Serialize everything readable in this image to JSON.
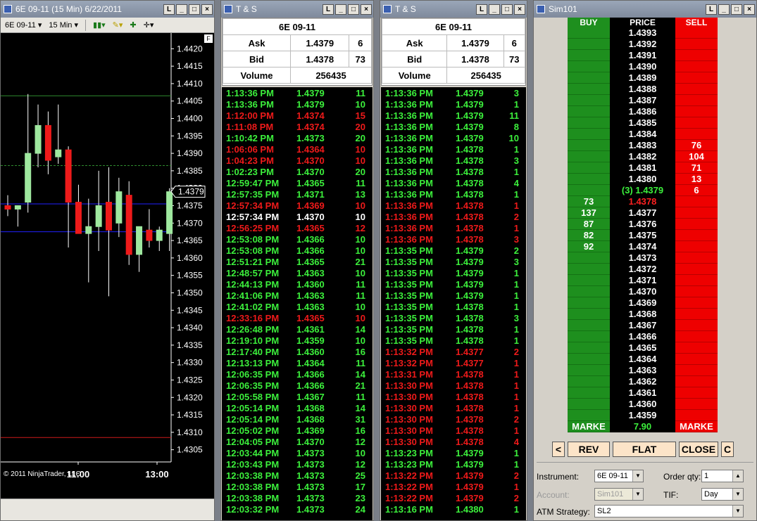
{
  "chart": {
    "title": "6E 09-11 (15 Min)  6/22/2011",
    "instrument": "6E 09-11",
    "interval": "15 Min",
    "copyright": "© 2011 NinjaTrader, LLC",
    "f_label": "F",
    "current_price": "1.4379",
    "y_ticks": [
      "1.4420",
      "1.4415",
      "1.4410",
      "1.4405",
      "1.4400",
      "1.4395",
      "1.4390",
      "1.4385",
      "1.4380",
      "1.4375",
      "1.4370",
      "1.4365",
      "1.4360",
      "1.4355",
      "1.4350",
      "1.4345",
      "1.4340",
      "1.4335",
      "1.4330",
      "1.4325",
      "1.4320",
      "1.4315",
      "1.4310",
      "1.4305"
    ],
    "x_ticks": [
      "11:00",
      "13:00"
    ],
    "candles": [
      {
        "o": 1.4375,
        "h": 1.4378,
        "l": 1.4372,
        "c": 1.4374
      },
      {
        "o": 1.4374,
        "h": 1.4375,
        "l": 1.4369,
        "c": 1.4375
      },
      {
        "o": 1.4376,
        "h": 1.4407,
        "l": 1.4373,
        "c": 1.439
      },
      {
        "o": 1.439,
        "h": 1.4404,
        "l": 1.4386,
        "c": 1.4398
      },
      {
        "o": 1.4398,
        "h": 1.4402,
        "l": 1.4384,
        "c": 1.4388
      },
      {
        "o": 1.4389,
        "h": 1.4404,
        "l": 1.4387,
        "c": 1.4391
      },
      {
        "o": 1.4391,
        "h": 1.4392,
        "l": 1.4363,
        "c": 1.4376
      },
      {
        "o": 1.4376,
        "h": 1.4381,
        "l": 1.4367,
        "c": 1.4367
      },
      {
        "o": 1.4367,
        "h": 1.4377,
        "l": 1.4353,
        "c": 1.4369
      },
      {
        "o": 1.4369,
        "h": 1.4385,
        "l": 1.4362,
        "c": 1.4375
      },
      {
        "o": 1.4376,
        "h": 1.4386,
        "l": 1.4349,
        "c": 1.4368
      },
      {
        "o": 1.437,
        "h": 1.4383,
        "l": 1.4366,
        "c": 1.4379
      },
      {
        "o": 1.4378,
        "h": 1.4382,
        "l": 1.4358,
        "c": 1.4361
      },
      {
        "o": 1.4361,
        "h": 1.4369,
        "l": 1.4356,
        "c": 1.4369
      },
      {
        "o": 1.4368,
        "h": 1.4374,
        "l": 1.4363,
        "c": 1.4365
      },
      {
        "o": 1.4365,
        "h": 1.4369,
        "l": 1.4362,
        "c": 1.4368
      },
      {
        "o": 1.4367,
        "h": 1.438,
        "l": 1.4362,
        "c": 1.4379
      }
    ],
    "h_lines": [
      {
        "price": 1.44065,
        "color": "#2e8b2e"
      },
      {
        "price": 1.43865,
        "color": "#2e8b2e"
      },
      {
        "price": 1.43755,
        "color": "#2020ff"
      },
      {
        "price": 1.43675,
        "color": "#2020ff"
      },
      {
        "price": 1.43085,
        "color": "#cc1a1a"
      }
    ]
  },
  "ts1": {
    "title": "T & S",
    "instrument": "6E 09-11",
    "ask_label": "Ask",
    "ask_price": "1.4379",
    "ask_size": "6",
    "bid_label": "Bid",
    "bid_price": "1.4378",
    "bid_size": "73",
    "volume_label": "Volume",
    "volume": "256435",
    "rows": [
      [
        "1:13:36 PM",
        "1.4379",
        "11",
        "g"
      ],
      [
        "1:13:36 PM",
        "1.4379",
        "10",
        "g"
      ],
      [
        "1:12:00 PM",
        "1.4374",
        "15",
        "r"
      ],
      [
        "1:11:08 PM",
        "1.4374",
        "20",
        "r"
      ],
      [
        "1:10:42 PM",
        "1.4373",
        "20",
        "g"
      ],
      [
        "1:06:06 PM",
        "1.4364",
        "10",
        "r"
      ],
      [
        "1:04:23 PM",
        "1.4370",
        "10",
        "r"
      ],
      [
        "1:02:23 PM",
        "1.4370",
        "20",
        "g"
      ],
      [
        "12:59:47 PM",
        "1.4365",
        "11",
        "g"
      ],
      [
        "12:57:35 PM",
        "1.4371",
        "13",
        "g"
      ],
      [
        "12:57:34 PM",
        "1.4369",
        "10",
        "r"
      ],
      [
        "12:57:34 PM",
        "1.4370",
        "10",
        "w"
      ],
      [
        "12:56:25 PM",
        "1.4365",
        "12",
        "r"
      ],
      [
        "12:53:08 PM",
        "1.4366",
        "10",
        "g"
      ],
      [
        "12:53:08 PM",
        "1.4366",
        "10",
        "g"
      ],
      [
        "12:51:21 PM",
        "1.4365",
        "21",
        "g"
      ],
      [
        "12:48:57 PM",
        "1.4363",
        "10",
        "g"
      ],
      [
        "12:44:13 PM",
        "1.4360",
        "11",
        "g"
      ],
      [
        "12:41:06 PM",
        "1.4363",
        "11",
        "g"
      ],
      [
        "12:41:02 PM",
        "1.4363",
        "10",
        "g"
      ],
      [
        "12:33:16 PM",
        "1.4365",
        "10",
        "r"
      ],
      [
        "12:26:48 PM",
        "1.4361",
        "14",
        "g"
      ],
      [
        "12:19:10 PM",
        "1.4359",
        "10",
        "g"
      ],
      [
        "12:17:40 PM",
        "1.4360",
        "16",
        "g"
      ],
      [
        "12:13:13 PM",
        "1.4364",
        "11",
        "g"
      ],
      [
        "12:06:35 PM",
        "1.4366",
        "14",
        "g"
      ],
      [
        "12:06:35 PM",
        "1.4366",
        "21",
        "g"
      ],
      [
        "12:05:58 PM",
        "1.4367",
        "11",
        "g"
      ],
      [
        "12:05:14 PM",
        "1.4368",
        "14",
        "g"
      ],
      [
        "12:05:14 PM",
        "1.4368",
        "31",
        "g"
      ],
      [
        "12:05:02 PM",
        "1.4369",
        "16",
        "g"
      ],
      [
        "12:04:05 PM",
        "1.4370",
        "12",
        "g"
      ],
      [
        "12:03:44 PM",
        "1.4373",
        "10",
        "g"
      ],
      [
        "12:03:43 PM",
        "1.4373",
        "12",
        "g"
      ],
      [
        "12:03:38 PM",
        "1.4373",
        "25",
        "g"
      ],
      [
        "12:03:38 PM",
        "1.4373",
        "17",
        "g"
      ],
      [
        "12:03:38 PM",
        "1.4373",
        "23",
        "g"
      ],
      [
        "12:03:32 PM",
        "1.4373",
        "24",
        "g"
      ]
    ]
  },
  "ts2": {
    "title": "T & S",
    "instrument": "6E 09-11",
    "ask_label": "Ask",
    "ask_price": "1.4379",
    "ask_size": "6",
    "bid_label": "Bid",
    "bid_price": "1.4378",
    "bid_size": "73",
    "volume_label": "Volume",
    "volume": "256435",
    "rows": [
      [
        "1:13:36 PM",
        "1.4379",
        "3",
        "g"
      ],
      [
        "1:13:36 PM",
        "1.4379",
        "1",
        "g"
      ],
      [
        "1:13:36 PM",
        "1.4379",
        "11",
        "g"
      ],
      [
        "1:13:36 PM",
        "1.4379",
        "8",
        "g"
      ],
      [
        "1:13:36 PM",
        "1.4379",
        "10",
        "g"
      ],
      [
        "1:13:36 PM",
        "1.4378",
        "1",
        "g"
      ],
      [
        "1:13:36 PM",
        "1.4378",
        "3",
        "g"
      ],
      [
        "1:13:36 PM",
        "1.4378",
        "1",
        "g"
      ],
      [
        "1:13:36 PM",
        "1.4378",
        "4",
        "g"
      ],
      [
        "1:13:36 PM",
        "1.4378",
        "1",
        "g"
      ],
      [
        "1:13:36 PM",
        "1.4378",
        "1",
        "r"
      ],
      [
        "1:13:36 PM",
        "1.4378",
        "2",
        "r"
      ],
      [
        "1:13:36 PM",
        "1.4378",
        "1",
        "r"
      ],
      [
        "1:13:36 PM",
        "1.4378",
        "3",
        "r"
      ],
      [
        "1:13:35 PM",
        "1.4379",
        "2",
        "g"
      ],
      [
        "1:13:35 PM",
        "1.4379",
        "3",
        "g"
      ],
      [
        "1:13:35 PM",
        "1.4379",
        "1",
        "g"
      ],
      [
        "1:13:35 PM",
        "1.4379",
        "1",
        "g"
      ],
      [
        "1:13:35 PM",
        "1.4379",
        "1",
        "g"
      ],
      [
        "1:13:35 PM",
        "1.4378",
        "1",
        "g"
      ],
      [
        "1:13:35 PM",
        "1.4378",
        "3",
        "g"
      ],
      [
        "1:13:35 PM",
        "1.4378",
        "1",
        "g"
      ],
      [
        "1:13:35 PM",
        "1.4378",
        "1",
        "g"
      ],
      [
        "1:13:32 PM",
        "1.4377",
        "2",
        "r"
      ],
      [
        "1:13:32 PM",
        "1.4377",
        "1",
        "r"
      ],
      [
        "1:13:31 PM",
        "1.4378",
        "1",
        "r"
      ],
      [
        "1:13:30 PM",
        "1.4378",
        "1",
        "r"
      ],
      [
        "1:13:30 PM",
        "1.4378",
        "1",
        "r"
      ],
      [
        "1:13:30 PM",
        "1.4378",
        "1",
        "r"
      ],
      [
        "1:13:30 PM",
        "1.4378",
        "2",
        "r"
      ],
      [
        "1:13:30 PM",
        "1.4378",
        "1",
        "r"
      ],
      [
        "1:13:30 PM",
        "1.4378",
        "4",
        "r"
      ],
      [
        "1:13:23 PM",
        "1.4379",
        "1",
        "g"
      ],
      [
        "1:13:23 PM",
        "1.4379",
        "1",
        "g"
      ],
      [
        "1:13:22 PM",
        "1.4379",
        "2",
        "r"
      ],
      [
        "1:13:22 PM",
        "1.4379",
        "1",
        "r"
      ],
      [
        "1:13:22 PM",
        "1.4379",
        "2",
        "r"
      ],
      [
        "1:13:16 PM",
        "1.4380",
        "1",
        "g"
      ]
    ]
  },
  "dom": {
    "title": "Sim101",
    "col_buy": "BUY",
    "col_price": "PRICE",
    "col_sell": "SELL",
    "rows": [
      [
        "",
        "1.4393",
        ""
      ],
      [
        "",
        "1.4392",
        ""
      ],
      [
        "",
        "1.4391",
        ""
      ],
      [
        "",
        "1.4390",
        ""
      ],
      [
        "",
        "1.4389",
        ""
      ],
      [
        "",
        "1.4388",
        ""
      ],
      [
        "",
        "1.4387",
        ""
      ],
      [
        "",
        "1.4386",
        ""
      ],
      [
        "",
        "1.4385",
        ""
      ],
      [
        "",
        "1.4384",
        ""
      ],
      [
        "",
        "1.4383",
        "76"
      ],
      [
        "",
        "1.4382",
        "104"
      ],
      [
        "",
        "1.4381",
        "71"
      ],
      [
        "",
        "1.4380",
        "13"
      ],
      [
        "",
        "(3) 1.4379",
        "6"
      ],
      [
        "73",
        "1.4378",
        ""
      ],
      [
        "137",
        "1.4377",
        ""
      ],
      [
        "87",
        "1.4376",
        ""
      ],
      [
        "82",
        "1.4375",
        ""
      ],
      [
        "92",
        "1.4374",
        ""
      ],
      [
        "",
        "1.4373",
        ""
      ],
      [
        "",
        "1.4372",
        ""
      ],
      [
        "",
        "1.4371",
        ""
      ],
      [
        "",
        "1.4370",
        ""
      ],
      [
        "",
        "1.4369",
        ""
      ],
      [
        "",
        "1.4368",
        ""
      ],
      [
        "",
        "1.4367",
        ""
      ],
      [
        "",
        "1.4366",
        ""
      ],
      [
        "",
        "1.4365",
        ""
      ],
      [
        "",
        "1.4364",
        ""
      ],
      [
        "",
        "1.4363",
        ""
      ],
      [
        "",
        "1.4362",
        ""
      ],
      [
        "",
        "1.4361",
        ""
      ],
      [
        "",
        "1.4360",
        ""
      ],
      [
        "",
        "1.4359",
        ""
      ]
    ],
    "market_buy": "MARKE",
    "pnl": "7.90",
    "market_sell": "MARKE",
    "btn_left": "<",
    "btn_rev": "REV",
    "btn_flat": "FLAT",
    "btn_close": "CLOSE",
    "btn_c": "C",
    "instrument_label": "Instrument:",
    "instrument": "6E 09-11",
    "orderqty_label": "Order qty:",
    "orderqty": "1",
    "account_label": "Account:",
    "account": "Sim101",
    "tif_label": "TIF:",
    "tif": "Day",
    "atm_label": "ATM Strategy:",
    "atm": "SL2"
  }
}
